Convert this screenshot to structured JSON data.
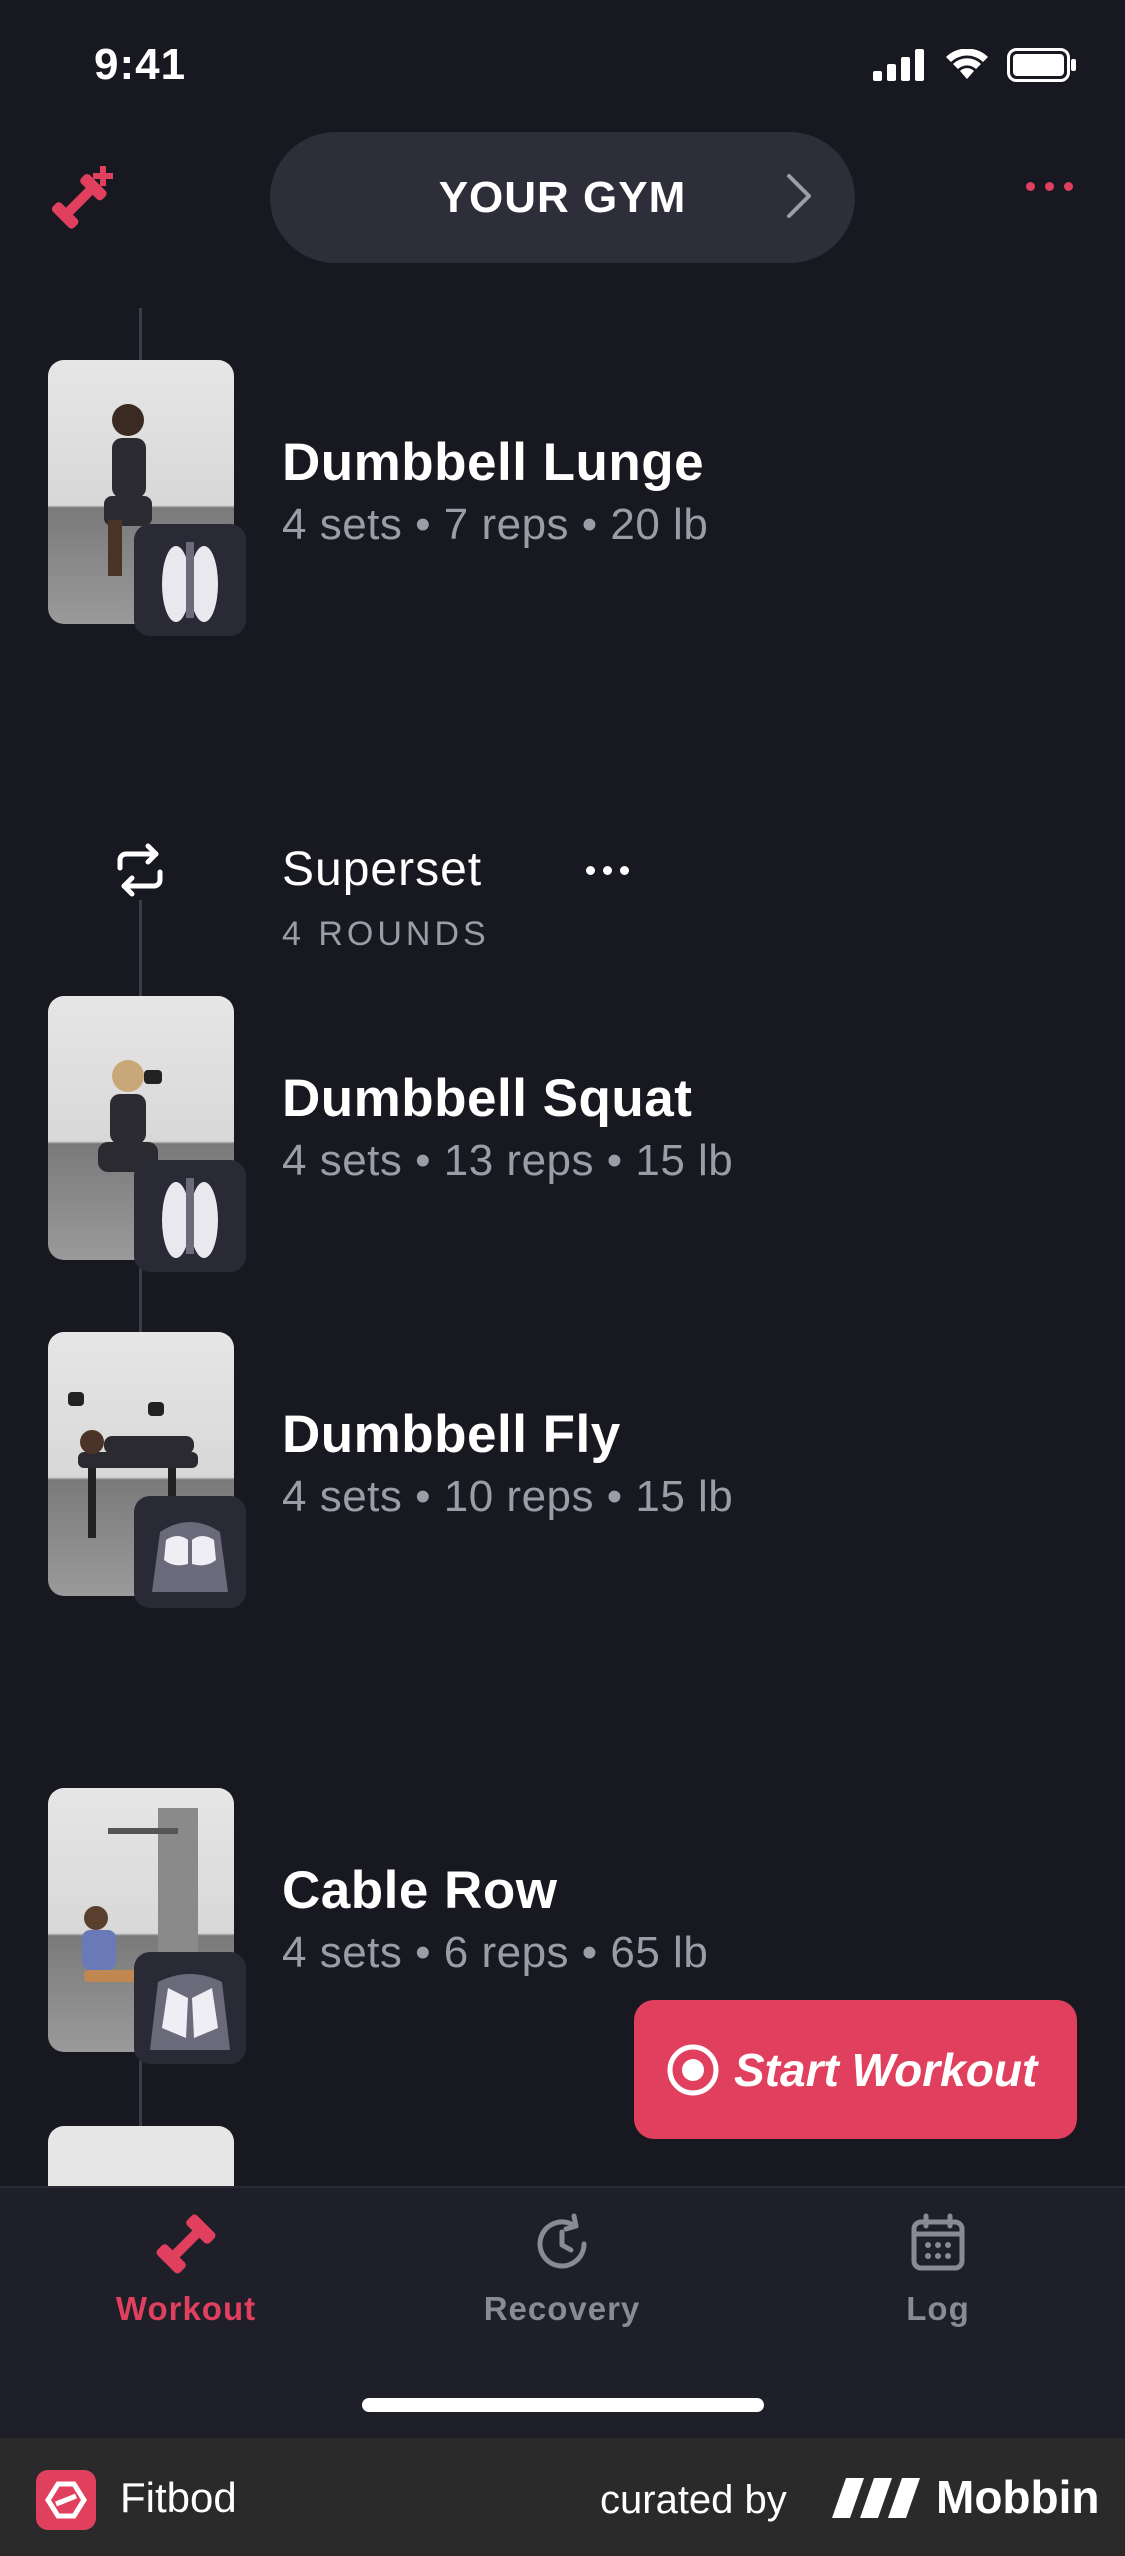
{
  "status_bar": {
    "time": "9:41"
  },
  "header": {
    "gym_label": "YOUR GYM"
  },
  "exercises": [
    {
      "name": "Dumbbell Lunge",
      "meta": "4 sets • 7 reps • 20 lb",
      "muscle": "quads"
    },
    {
      "name": "Dumbbell Squat",
      "meta": "4 sets • 13 reps • 15 lb",
      "muscle": "quads"
    },
    {
      "name": "Dumbbell Fly",
      "meta": "4 sets • 10 reps • 15 lb",
      "muscle": "chest"
    },
    {
      "name": "Cable Row",
      "meta": "4 sets • 6 reps • 65 lb",
      "muscle": "back"
    }
  ],
  "superset": {
    "title": "Superset",
    "rounds": "4 ROUNDS"
  },
  "start_button": {
    "label": "Start Workout"
  },
  "tabs": [
    {
      "label": "Workout",
      "icon": "dumbbell-icon",
      "active": true
    },
    {
      "label": "Recovery",
      "icon": "recovery-clock-icon",
      "active": false
    },
    {
      "label": "Log",
      "icon": "calendar-icon",
      "active": false
    }
  ],
  "footer": {
    "app_name": "Fitbod",
    "curated_by": "curated by",
    "brand": "Mobbin"
  },
  "colors": {
    "accent": "#e0405e",
    "background": "#181821",
    "muted_text": "#9c9ca6"
  }
}
